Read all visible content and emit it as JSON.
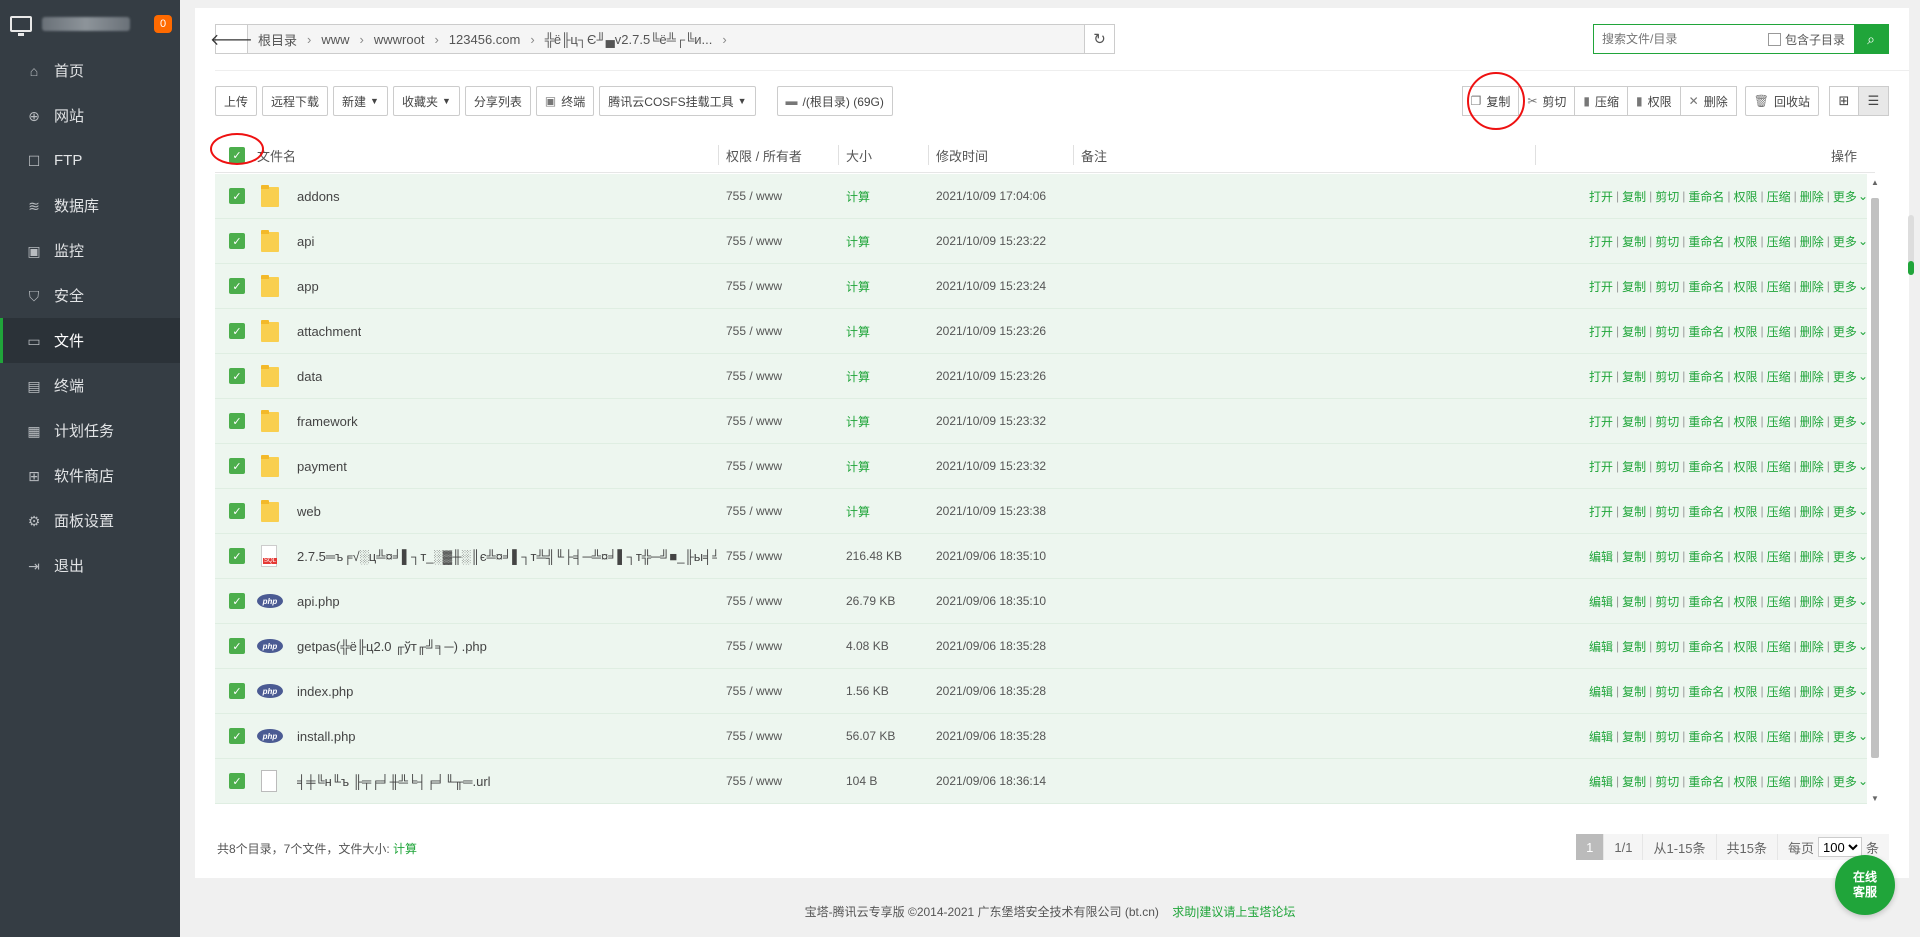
{
  "sidebar": {
    "badge": "0",
    "items": [
      {
        "label": "首页",
        "icon": "home-icon",
        "glyph": "⌂"
      },
      {
        "label": "网站",
        "icon": "globe-icon",
        "glyph": "⊕"
      },
      {
        "label": "FTP",
        "icon": "ftp-icon",
        "glyph": "☐"
      },
      {
        "label": "数据库",
        "icon": "database-icon",
        "glyph": "≋"
      },
      {
        "label": "监控",
        "icon": "monitor-icon",
        "glyph": "▣"
      },
      {
        "label": "安全",
        "icon": "shield-icon",
        "glyph": "⛉"
      },
      {
        "label": "文件",
        "icon": "folder-icon",
        "glyph": "▭"
      },
      {
        "label": "终端",
        "icon": "terminal-icon",
        "glyph": "▤"
      },
      {
        "label": "计划任务",
        "icon": "calendar-icon",
        "glyph": "▦"
      },
      {
        "label": "软件商店",
        "icon": "apps-icon",
        "glyph": "⊞"
      },
      {
        "label": "面板设置",
        "icon": "gear-icon",
        "glyph": "⚙"
      },
      {
        "label": "退出",
        "icon": "logout-icon",
        "glyph": "⇥"
      }
    ],
    "active_index": 6
  },
  "path": {
    "crumbs": [
      "根目录",
      "www",
      "wwwroot",
      "123456.com",
      "╬ё╟ц┐Є╜▄v2.7.5╚ё╩┌╚и..."
    ]
  },
  "search": {
    "placeholder": "搜索文件/目录",
    "include_sub_label": "包含子目录"
  },
  "toolbar": {
    "upload": "上传",
    "remote_download": "远程下载",
    "new": "新建",
    "favorites": "收藏夹",
    "share_list": "分享列表",
    "terminal": "终端",
    "cosfs": "腾讯云COSFS挂载工具",
    "disk": "/(根目录) (69G)",
    "copy": "复制",
    "cut": "剪切",
    "compress": "压缩",
    "permission": "权限",
    "delete": "删除",
    "recycle": "回收站"
  },
  "table": {
    "headers": {
      "name": "文件名",
      "perm": "权限 / 所有者",
      "size": "大小",
      "mtime": "修改时间",
      "remark": "备注",
      "ops": "操作"
    },
    "rows": [
      {
        "type": "folder",
        "name": "addons",
        "perm": "755 / www",
        "size": "计算",
        "mtime": "2021/10/09 17:04:06",
        "first_op": "打开"
      },
      {
        "type": "folder",
        "name": "api",
        "perm": "755 / www",
        "size": "计算",
        "mtime": "2021/10/09 15:23:22",
        "first_op": "打开"
      },
      {
        "type": "folder",
        "name": "app",
        "perm": "755 / www",
        "size": "计算",
        "mtime": "2021/10/09 15:23:24",
        "first_op": "打开"
      },
      {
        "type": "folder",
        "name": "attachment",
        "perm": "755 / www",
        "size": "计算",
        "mtime": "2021/10/09 15:23:26",
        "first_op": "打开"
      },
      {
        "type": "folder",
        "name": "data",
        "perm": "755 / www",
        "size": "计算",
        "mtime": "2021/10/09 15:23:26",
        "first_op": "打开"
      },
      {
        "type": "folder",
        "name": "framework",
        "perm": "755 / www",
        "size": "计算",
        "mtime": "2021/10/09 15:23:32",
        "first_op": "打开"
      },
      {
        "type": "folder",
        "name": "payment",
        "perm": "755 / www",
        "size": "计算",
        "mtime": "2021/10/09 15:23:32",
        "first_op": "打开"
      },
      {
        "type": "folder",
        "name": "web",
        "perm": "755 / www",
        "size": "计算",
        "mtime": "2021/10/09 15:23:38",
        "first_op": "打开"
      },
      {
        "type": "sql",
        "name": "2.7.5═ъ╒√░ц╩¤╛▌┐т_░▓╫░║є╩¤╛▌┐т╩╣╙├╡─╩¤╛▌┐т╬─╝■_╟ы╡╝╚ы╡╜╩¤╛▌┐т╓╨...",
        "perm": "755 / www",
        "size": "216.48 KB",
        "mtime": "2021/09/06 18:35:10",
        "first_op": "编辑"
      },
      {
        "type": "php",
        "name": "api.php",
        "perm": "755 / www",
        "size": "26.79 KB",
        "mtime": "2021/09/06 18:35:10",
        "first_op": "编辑"
      },
      {
        "type": "php",
        "name": "getpas(╬ё╟ц2.0 ╓ўт╓╝╕─) .php",
        "perm": "755 / www",
        "size": "4.08 KB",
        "mtime": "2021/09/06 18:35:28",
        "first_op": "编辑"
      },
      {
        "type": "php",
        "name": "index.php",
        "perm": "755 / www",
        "size": "1.56 KB",
        "mtime": "2021/09/06 18:35:28",
        "first_op": "编辑"
      },
      {
        "type": "php",
        "name": "install.php",
        "perm": "755 / www",
        "size": "56.07 KB",
        "mtime": "2021/09/06 18:35:28",
        "first_op": "编辑"
      },
      {
        "type": "file",
        "name": "╡╪╚н╙ъ ╟╤╒╛╫╩╘┤╒╛╙╥═.url",
        "perm": "755 / www",
        "size": "104 B",
        "mtime": "2021/09/06 18:36:14",
        "first_op": "编辑"
      }
    ],
    "ops": [
      "复制",
      "剪切",
      "重命名",
      "权限",
      "压缩",
      "删除",
      "更多"
    ]
  },
  "footer": {
    "summary": "共8个目录，7个文件，文件大小:",
    "calc": "计算",
    "page_current": "1",
    "page_total": "1/1",
    "range": "从1-15条",
    "count": "共15条",
    "per_page_label": "每页",
    "per_page_value": "100",
    "unit": "条"
  },
  "bottom": {
    "copyright": "宝塔-腾讯云专享版 ©2014-2021 广东堡塔安全技术有限公司 (bt.cn)",
    "forum_link": "求助|建议请上宝塔论坛"
  },
  "service": {
    "line1": "在线",
    "line2": "客服"
  },
  "colors": {
    "accent": "#20a53a",
    "sidebar": "#353d44",
    "row_selected": "#edf6ef",
    "highlight_circle": "#e11111"
  }
}
